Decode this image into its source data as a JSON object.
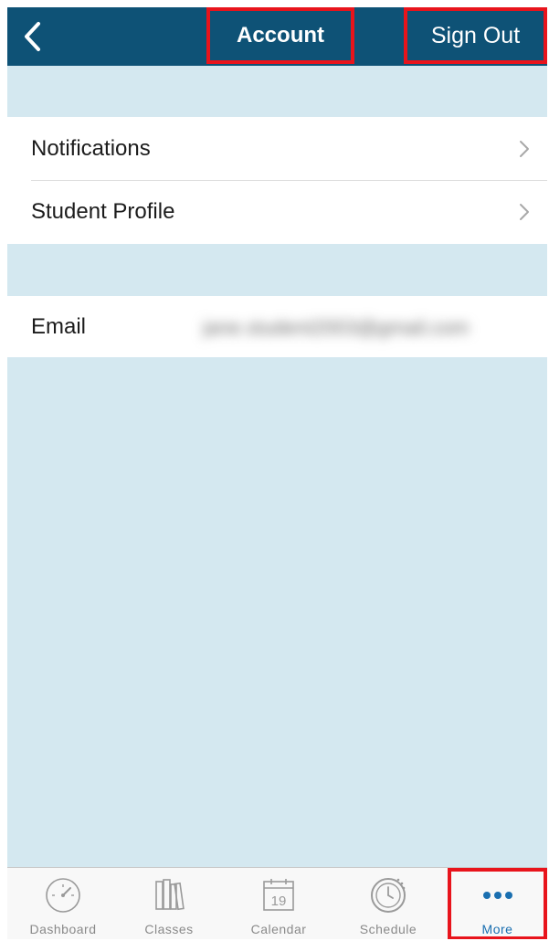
{
  "header": {
    "title": "Account",
    "sign_out_label": "Sign Out",
    "background_color": "#0e5276",
    "back_icon": "chevron-left-icon"
  },
  "settings_group": {
    "items": [
      {
        "label": "Notifications",
        "icon": "chevron-right-icon"
      },
      {
        "label": "Student Profile",
        "icon": "chevron-right-icon"
      }
    ]
  },
  "account_group": {
    "email_label": "Email",
    "email_value": "jane.student2003@gmail.com"
  },
  "tabbar": {
    "items": [
      {
        "label": "Dashboard",
        "icon": "speedometer-icon"
      },
      {
        "label": "Classes",
        "icon": "books-icon"
      },
      {
        "label": "Calendar",
        "icon": "calendar-icon"
      },
      {
        "label": "Schedule",
        "icon": "clock-icon"
      },
      {
        "label": "More",
        "icon": "more-dots-icon"
      }
    ],
    "active": "More",
    "active_color": "#1a6fb0"
  },
  "colors": {
    "background": "#d4e8f0",
    "highlight_border": "#e8141c"
  },
  "calendar_day": "19"
}
